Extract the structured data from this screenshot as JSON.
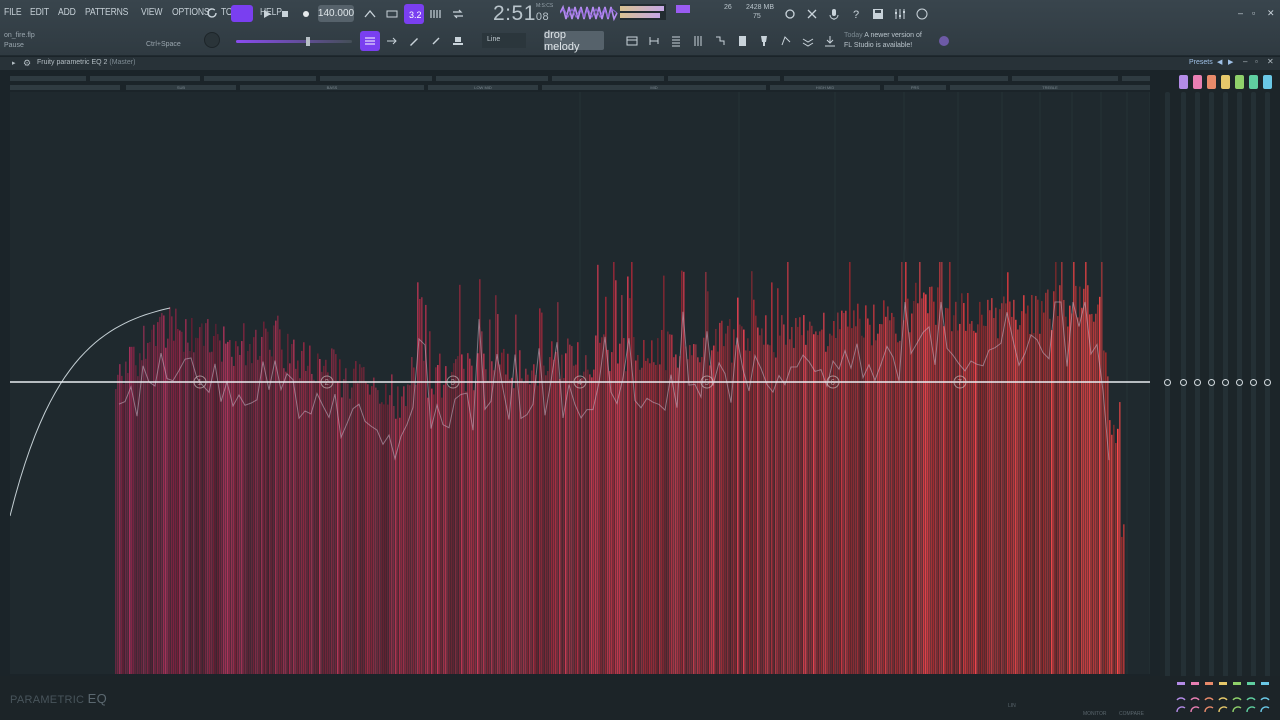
{
  "menu": [
    "FILE",
    "EDIT",
    "ADD",
    "PATTERNS",
    "VIEW",
    "OPTIONS",
    "TOOLS",
    "HELP"
  ],
  "transport": {
    "tempo": "140.000",
    "time_main": "2:51",
    "time_sub": "08",
    "time_unit": "M:S:CS"
  },
  "cpu": {
    "value": "26",
    "memory": "2428 MB",
    "voices": "75"
  },
  "hint": {
    "file": "on_fire.flp",
    "action": "Pause",
    "shortcut": "Ctrl+Space"
  },
  "tool": {
    "snap": "Line",
    "pattern": "drop melody"
  },
  "news": {
    "day": "Today",
    "line1": "A newer version of",
    "line2": "FL Studio is available!"
  },
  "plugin": {
    "title": "Fruity parametric EQ 2",
    "target": "(Master)",
    "presets": "Presets",
    "brand_prefix": "PARAMETRIC",
    "brand_suffix": "EQ"
  },
  "bands": [
    "SUB",
    "BASS",
    "LOW MID",
    "MID",
    "HIGH MID",
    "PRS",
    "TREBLE"
  ],
  "band_nodes": [
    "1",
    "2",
    "3",
    "4",
    "5",
    "6",
    "7"
  ],
  "footer": {
    "lin": "LIN",
    "monitor": "MONITOR",
    "compare": "COMPARE"
  },
  "colors": {
    "accent": "#7a3ff0",
    "spectrum_low": "#6b3a63",
    "spectrum_high": "#e0504e",
    "band_swatches": [
      "#b38be6",
      "#e87fb3",
      "#e88a6a",
      "#e6c86a",
      "#8fd16a",
      "#5fcfa0",
      "#6ac8e6"
    ]
  }
}
